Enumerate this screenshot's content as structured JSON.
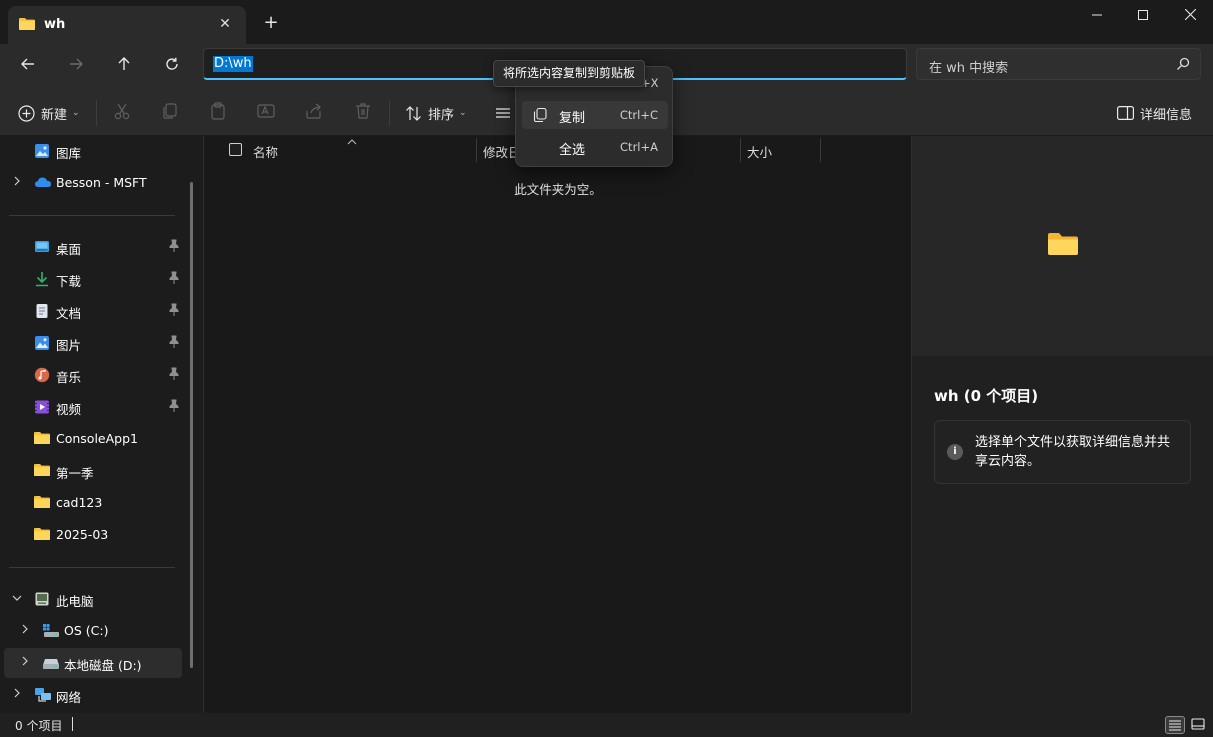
{
  "tab": {
    "title": "wh",
    "close_label": "✕",
    "new_tab_label": "+"
  },
  "window": {
    "minimize": "—",
    "maximize": "☐",
    "close": "✕"
  },
  "address": {
    "path": "D:\\wh",
    "search_placeholder": "在 wh 中搜索"
  },
  "toolbar": {
    "new_label": "新建",
    "sort_label": "排序",
    "details_label": "详细信息"
  },
  "tooltip": {
    "text": "将所选内容复制到剪贴板"
  },
  "context_menu": {
    "items": [
      {
        "label": "复制",
        "shortcut": "Ctrl+C"
      },
      {
        "label": "全选",
        "shortcut": "Ctrl+A"
      }
    ],
    "partial_shortcut": "+X"
  },
  "sidebar": {
    "top": [
      {
        "label": "图库"
      },
      {
        "label": "Besson - MSFT"
      }
    ],
    "quick_access": [
      {
        "label": "桌面"
      },
      {
        "label": "下载"
      },
      {
        "label": "文档"
      },
      {
        "label": "图片"
      },
      {
        "label": "音乐"
      },
      {
        "label": "视频"
      },
      {
        "label": "ConsoleApp1"
      },
      {
        "label": "第一季"
      },
      {
        "label": "cad123"
      },
      {
        "label": "2025-03"
      }
    ],
    "this_pc": {
      "label": "此电脑"
    },
    "drives": [
      {
        "label": "OS (C:)"
      },
      {
        "label": "本地磁盘 (D:)"
      }
    ],
    "network": {
      "label": "网络"
    }
  },
  "columns": {
    "name": "名称",
    "modified": "修改日",
    "size": "大小"
  },
  "content": {
    "empty_message": "此文件夹为空。"
  },
  "details": {
    "title": "wh (0 个项目)",
    "info_text": "选择单个文件以获取详细信息并共享云内容。",
    "info_icon": "i"
  },
  "status": {
    "item_count": "0 个项目"
  },
  "colors": {
    "accent": "#4cc2ff",
    "selection": "#0078d4",
    "folder": "#f5c242"
  }
}
